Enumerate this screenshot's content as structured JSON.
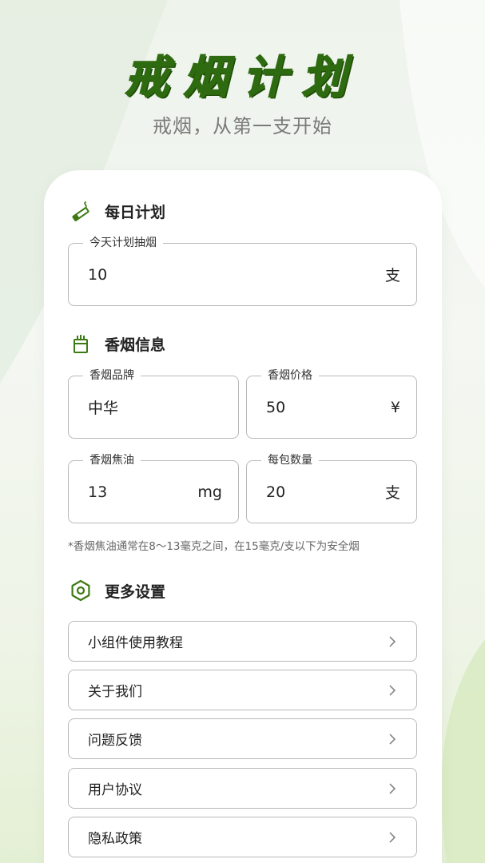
{
  "hero": {
    "title": "戒烟计划",
    "subtitle": "戒烟，从第一支开始"
  },
  "colors": {
    "brand_green": "#2e6b10",
    "icon_green": "#3e7a14",
    "border_gray": "#b9b9b9"
  },
  "daily_plan": {
    "section_label": "每日计划",
    "icon": "cigarette-icon",
    "field": {
      "legend": "今天计划抽烟",
      "value": "10",
      "unit": "支"
    }
  },
  "cigarette_info": {
    "section_label": "香烟信息",
    "icon": "cigarette-pack-icon",
    "brand": {
      "legend": "香烟品牌",
      "value": "中华"
    },
    "price": {
      "legend": "香烟价格",
      "value": "50",
      "unit": "¥"
    },
    "tar": {
      "legend": "香烟焦油",
      "value": "13",
      "unit": "mg"
    },
    "per_pack": {
      "legend": "每包数量",
      "value": "20",
      "unit": "支"
    },
    "note": "*香烟焦油通常在8～13毫克之间，在15毫克/支以下为安全烟"
  },
  "more_settings": {
    "section_label": "更多设置",
    "icon": "hexagon-settings-icon",
    "items": [
      {
        "label": "小组件使用教程"
      },
      {
        "label": "关于我们"
      },
      {
        "label": "问题反馈"
      },
      {
        "label": "用户协议"
      },
      {
        "label": "隐私政策"
      }
    ]
  }
}
